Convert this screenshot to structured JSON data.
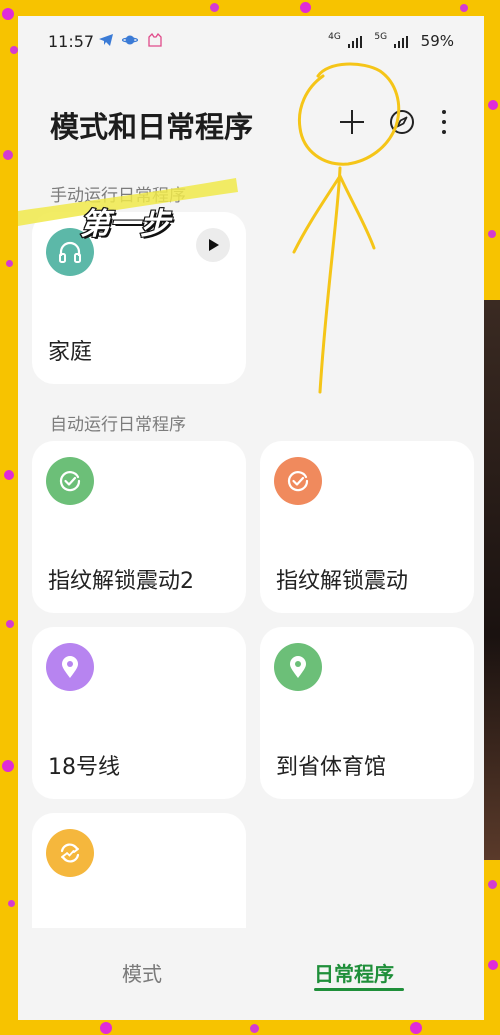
{
  "status_bar": {
    "time": "11:57",
    "network_1": "4G",
    "network_2": "5G",
    "battery": "59%"
  },
  "header": {
    "title": "模式和日常程序",
    "add_icon": "plus-icon",
    "explore_icon": "compass-icon",
    "more_icon": "more-vertical-icon"
  },
  "sections": {
    "manual_label": "手动运行日常程序",
    "auto_label": "自动运行日常程序"
  },
  "manual_routines": [
    {
      "label": "家庭",
      "icon": "headphones-icon",
      "color": "#5cb8a8"
    }
  ],
  "auto_routines": [
    {
      "label": "指纹解锁震动2",
      "icon": "check-icon",
      "color": "#6cbf78"
    },
    {
      "label": "指纹解锁震动",
      "icon": "check-icon",
      "color": "#f08a5d"
    },
    {
      "label": "18号线",
      "icon": "location-pin-icon",
      "color": "#b784f0"
    },
    {
      "label": "到省体育馆",
      "icon": "location-pin-icon",
      "color": "#6cbf78"
    },
    {
      "label": "",
      "icon": "sync-icon",
      "color": "#f5b73d"
    }
  ],
  "tabs": {
    "modes": "模式",
    "routines": "日常程序",
    "active": "routines",
    "accent": "#1f8f3a"
  },
  "annotation": {
    "text": "第一步",
    "highlight_color": "#f0e94a",
    "stroke_color": "#f5c518"
  }
}
